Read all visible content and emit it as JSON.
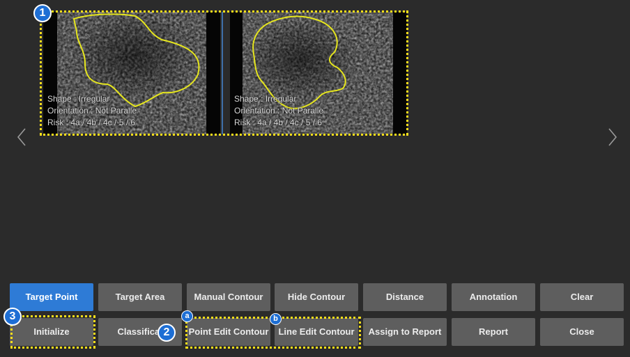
{
  "badges": {
    "one": "1",
    "two": "2",
    "three": "3",
    "a": "a",
    "b": "b"
  },
  "panels": {
    "left": {
      "shape": "Shape : Irregular",
      "orientation": "Orientation : Not Paralle",
      "risk": "Risk : 4a / 4b / 4c / 5 / 6"
    },
    "right": {
      "shape": "Shape : Irregular",
      "orientation": "Orientation : Not Paralle",
      "risk": "Risk : 4a / 4b / 4c / 5 / 6"
    }
  },
  "icons": {
    "prev": "chevron-left-icon",
    "next": "chevron-right-icon"
  },
  "toolbar": {
    "row1": {
      "target_point": "Target Point",
      "target_area": "Target Area",
      "manual_contour": "Manual Contour",
      "hide_contour": "Hide Contour",
      "distance": "Distance",
      "annotation": "Annotation",
      "clear": "Clear"
    },
    "row2": {
      "initialize": "Initialize",
      "classification": "Classificat",
      "point_edit_contour": "Point Edit Contour",
      "line_edit_contour": "Line Edit Contour",
      "assign_to_report": "Assign to Report",
      "report": "Report",
      "close": "Close"
    }
  },
  "colors": {
    "accent": "#2e7bd6",
    "highlight": "#ffe01a",
    "button": "#5e5e5e",
    "background": "#2b2b2b",
    "contour": "#e6e61e"
  }
}
